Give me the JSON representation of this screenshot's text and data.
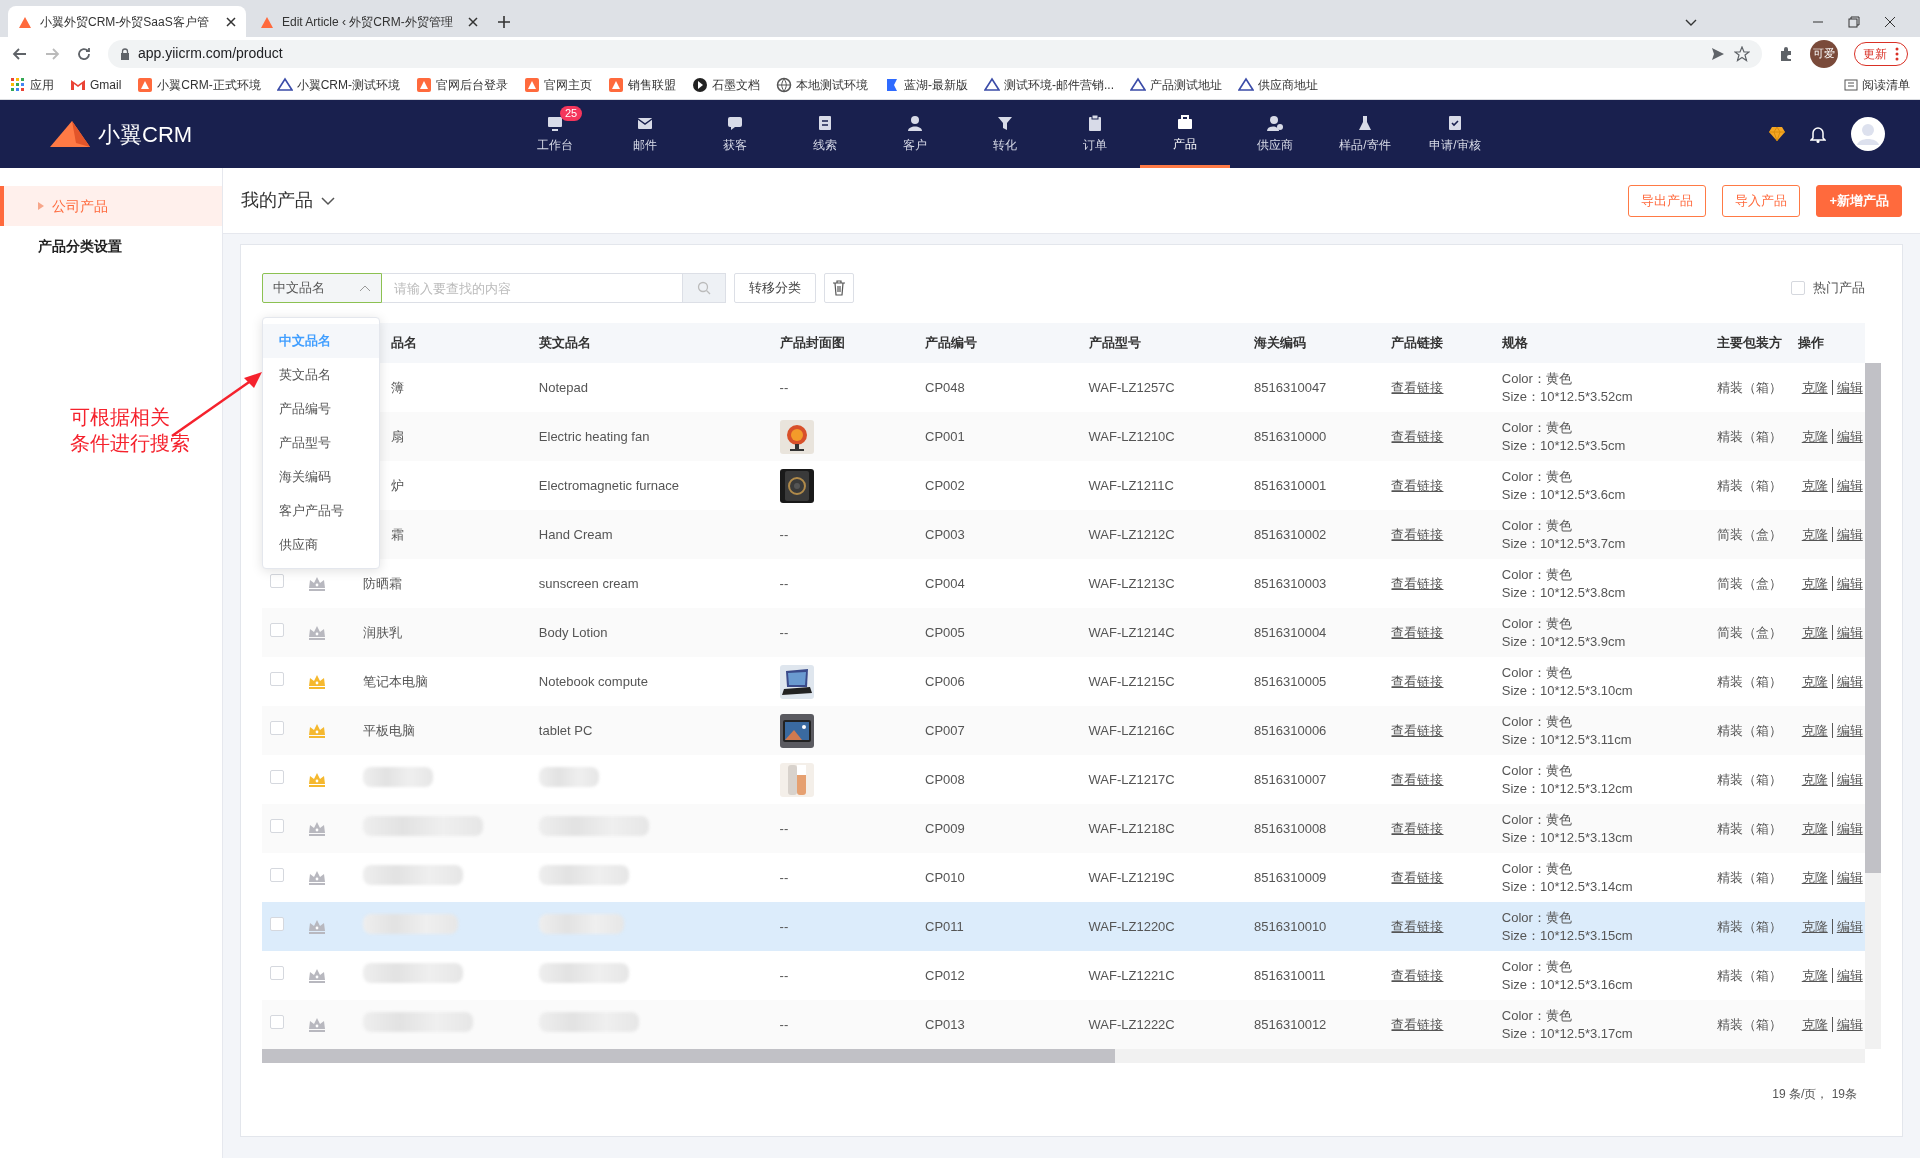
{
  "browser": {
    "tabs": [
      {
        "title": "小翼外贸CRM-外贸SaaS客户管",
        "selected": true
      },
      {
        "title": "Edit Article ‹ 外贸CRM-外贸管理",
        "selected": false
      }
    ],
    "address": "app.yiicrm.com/product",
    "profile": "可爱",
    "update_button": "更新",
    "bookmarks": [
      {
        "kind": "apps",
        "label": "应用"
      },
      {
        "kind": "mail",
        "label": "Gmail"
      },
      {
        "kind": "orange",
        "label": "小翼CRM-正式环境"
      },
      {
        "kind": "blue",
        "label": "小翼CRM-测试环境"
      },
      {
        "kind": "orange",
        "label": "官网后台登录"
      },
      {
        "kind": "orange",
        "label": "官网主页"
      },
      {
        "kind": "orange",
        "label": "销售联盟"
      },
      {
        "kind": "dark",
        "label": "石墨文档"
      },
      {
        "kind": "globe",
        "label": "本地测试环境"
      },
      {
        "kind": "lanhu",
        "label": "蓝湖-最新版"
      },
      {
        "kind": "blue",
        "label": "测试环境-邮件营销..."
      },
      {
        "kind": "blue",
        "label": "产品测试地址"
      },
      {
        "kind": "blue",
        "label": "供应商地址"
      }
    ],
    "reading_list": "阅读清单"
  },
  "app": {
    "logo": "小翼CRM",
    "nav": [
      {
        "label": "工作台",
        "badge": "25",
        "selected": false
      },
      {
        "label": "邮件",
        "selected": false
      },
      {
        "label": "获客",
        "selected": false
      },
      {
        "label": "线索",
        "selected": false
      },
      {
        "label": "客户",
        "selected": false
      },
      {
        "label": "转化",
        "selected": false
      },
      {
        "label": "订单",
        "selected": false
      },
      {
        "label": "产品",
        "selected": true
      },
      {
        "label": "供应商",
        "selected": false
      },
      {
        "label": "样品/寄件",
        "selected": false
      },
      {
        "label": "申请/审核",
        "selected": false
      }
    ]
  },
  "sidebar": {
    "items": [
      {
        "label": "公司产品",
        "selected": true
      },
      {
        "label": "产品分类设置",
        "selected": false
      }
    ]
  },
  "header": {
    "title": "我的产品",
    "buttons": [
      {
        "label": "导出产品",
        "kind": "outline"
      },
      {
        "label": "导入产品",
        "kind": "outline"
      },
      {
        "label": "+新增产品",
        "kind": "primary"
      }
    ]
  },
  "toolbar": {
    "field_select": {
      "value": "中文品名",
      "expanded": true,
      "options": [
        {
          "label": "中文品名",
          "selected": true
        },
        {
          "label": "英文品名",
          "selected": false
        },
        {
          "label": "产品编号",
          "selected": false
        },
        {
          "label": "产品型号",
          "selected": false
        },
        {
          "label": "海关编码",
          "selected": false
        },
        {
          "label": "客户产品号",
          "selected": false
        },
        {
          "label": "供应商",
          "selected": false
        }
      ]
    },
    "search": {
      "placeholder": "请输入要查找的内容"
    },
    "move_button": "转移分类",
    "hot_filter": {
      "label": "热门产品",
      "checked": false
    }
  },
  "annotation": {
    "lines": [
      "可根据相关",
      "条件进行搜索"
    ]
  },
  "table": {
    "columns": [
      "品名",
      "英文品名",
      "产品封面图",
      "产品编号",
      "产品型号",
      "海关编码",
      "产品链接",
      "规格",
      "主要包装方",
      "操作"
    ],
    "rows": [
      {
        "name": "簿",
        "clipped": true,
        "blurred": false,
        "highlighted": false,
        "en": "Notepad",
        "cover": {
          "kind": "text",
          "text": "--"
        },
        "code": "CP048",
        "model": "WAF-LZ1257C",
        "hs": "8516310047",
        "link": "查看链接",
        "spec": [
          "Color：黄色",
          "Size：10*12.5*3.52cm"
        ],
        "pack": "精装（箱）",
        "ops": [
          "克隆",
          "编辑"
        ]
      },
      {
        "name": "扇",
        "clipped": true,
        "blurred": false,
        "highlighted": false,
        "en": "Electric heating fan",
        "cover": {
          "kind": "picture"
        },
        "code": "CP001",
        "model": "WAF-LZ1210C",
        "hs": "8516310000",
        "link": "查看链接",
        "spec": [
          "Color：黄色",
          "Size：10*12.5*3.5cm"
        ],
        "pack": "精装（箱）",
        "ops": [
          "克隆",
          "编辑"
        ]
      },
      {
        "name": "炉",
        "clipped": true,
        "blurred": false,
        "highlighted": false,
        "en": "Electromagnetic furnace",
        "cover": {
          "kind": "picture"
        },
        "code": "CP002",
        "model": "WAF-LZ1211C",
        "hs": "8516310001",
        "link": "查看链接",
        "spec": [
          "Color：黄色",
          "Size：10*12.5*3.6cm"
        ],
        "pack": "精装（箱）",
        "ops": [
          "克隆",
          "编辑"
        ]
      },
      {
        "name": "霜",
        "clipped": true,
        "blurred": false,
        "highlighted": false,
        "en": "Hand Cream",
        "cover": {
          "kind": "text",
          "text": "--"
        },
        "code": "CP003",
        "model": "WAF-LZ1212C",
        "hs": "8516310002",
        "link": "查看链接",
        "spec": [
          "Color：黄色",
          "Size：10*12.5*3.7cm"
        ],
        "pack": "简装（盒）",
        "ops": [
          "克隆",
          "编辑"
        ]
      },
      {
        "checked": false,
        "hot": false,
        "name": "防晒霜",
        "clipped": false,
        "blurred": false,
        "highlighted": false,
        "en": "sunscreen cream",
        "cover": {
          "kind": "text",
          "text": "--"
        },
        "code": "CP004",
        "model": "WAF-LZ1213C",
        "hs": "8516310003",
        "link": "查看链接",
        "spec": [
          "Color：黄色",
          "Size：10*12.5*3.8cm"
        ],
        "pack": "简装（盒）",
        "ops": [
          "克隆",
          "编辑"
        ]
      },
      {
        "checked": false,
        "hot": false,
        "name": "润肤乳",
        "clipped": false,
        "blurred": false,
        "highlighted": false,
        "en": "Body Lotion",
        "cover": {
          "kind": "text",
          "text": "--"
        },
        "code": "CP005",
        "model": "WAF-LZ1214C",
        "hs": "8516310004",
        "link": "查看链接",
        "spec": [
          "Color：黄色",
          "Size：10*12.5*3.9cm"
        ],
        "pack": "简装（盒）",
        "ops": [
          "克隆",
          "编辑"
        ]
      },
      {
        "checked": false,
        "hot": true,
        "name": "笔记本电脑",
        "clipped": false,
        "blurred": false,
        "highlighted": false,
        "en": "Notebook compute",
        "cover": {
          "kind": "picture"
        },
        "code": "CP006",
        "model": "WAF-LZ1215C",
        "hs": "8516310005",
        "link": "查看链接",
        "spec": [
          "Color：黄色",
          "Size：10*12.5*3.10cm"
        ],
        "pack": "精装（箱）",
        "ops": [
          "克隆",
          "编辑"
        ]
      },
      {
        "checked": false,
        "hot": true,
        "name": "平板电脑",
        "clipped": false,
        "blurred": false,
        "highlighted": false,
        "en": "tablet PC",
        "cover": {
          "kind": "picture"
        },
        "code": "CP007",
        "model": "WAF-LZ1216C",
        "hs": "8516310006",
        "link": "查看链接",
        "spec": [
          "Color：黄色",
          "Size：10*12.5*3.11cm"
        ],
        "pack": "精装（箱）",
        "ops": [
          "克隆",
          "编辑"
        ]
      },
      {
        "checked": false,
        "hot": true,
        "blurred": true,
        "highlighted": false,
        "cover": {
          "kind": "picture"
        },
        "code": "CP008",
        "model": "WAF-LZ1217C",
        "hs": "8516310007",
        "link": "查看链接",
        "spec": [
          "Color：黄色",
          "Size：10*12.5*3.12cm"
        ],
        "pack": "精装（箱）",
        "ops": [
          "克隆",
          "编辑"
        ]
      },
      {
        "checked": false,
        "hot": false,
        "blurred": true,
        "highlighted": false,
        "cover": {
          "kind": "text",
          "text": "--"
        },
        "code": "CP009",
        "model": "WAF-LZ1218C",
        "hs": "8516310008",
        "link": "查看链接",
        "spec": [
          "Color：黄色",
          "Size：10*12.5*3.13cm"
        ],
        "pack": "精装（箱）",
        "ops": [
          "克隆",
          "编辑"
        ]
      },
      {
        "checked": false,
        "hot": false,
        "blurred": true,
        "highlighted": false,
        "cover": {
          "kind": "text",
          "text": "--"
        },
        "code": "CP010",
        "model": "WAF-LZ1219C",
        "hs": "8516310009",
        "link": "查看链接",
        "spec": [
          "Color：黄色",
          "Size：10*12.5*3.14cm"
        ],
        "pack": "精装（箱）",
        "ops": [
          "克隆",
          "编辑"
        ]
      },
      {
        "checked": false,
        "hot": false,
        "blurred": true,
        "highlighted": true,
        "cover": {
          "kind": "text",
          "text": "--"
        },
        "code": "CP011",
        "model": "WAF-LZ1220C",
        "hs": "8516310010",
        "link": "查看链接",
        "spec": [
          "Color：黄色",
          "Size：10*12.5*3.15cm"
        ],
        "pack": "精装（箱）",
        "ops": [
          "克隆",
          "编辑"
        ]
      },
      {
        "checked": false,
        "hot": false,
        "blurred": true,
        "highlighted": false,
        "cover": {
          "kind": "text",
          "text": "--"
        },
        "code": "CP012",
        "model": "WAF-LZ1221C",
        "hs": "8516310011",
        "link": "查看链接",
        "spec": [
          "Color：黄色",
          "Size：10*12.5*3.16cm"
        ],
        "pack": "精装（箱）",
        "ops": [
          "克隆",
          "编辑"
        ]
      },
      {
        "checked": false,
        "hot": false,
        "blurred": true,
        "highlighted": false,
        "cover": {
          "kind": "text",
          "text": "--"
        },
        "code": "CP013",
        "model": "WAF-LZ1222C",
        "hs": "8516310012",
        "link": "查看链接",
        "spec": [
          "Color：黄色",
          "Size：10*12.5*3.17cm"
        ],
        "pack": "精装（箱）",
        "ops": [
          "克隆",
          "编辑"
        ]
      }
    ]
  },
  "pagination": {
    "text": "19 条/页， 19条"
  }
}
